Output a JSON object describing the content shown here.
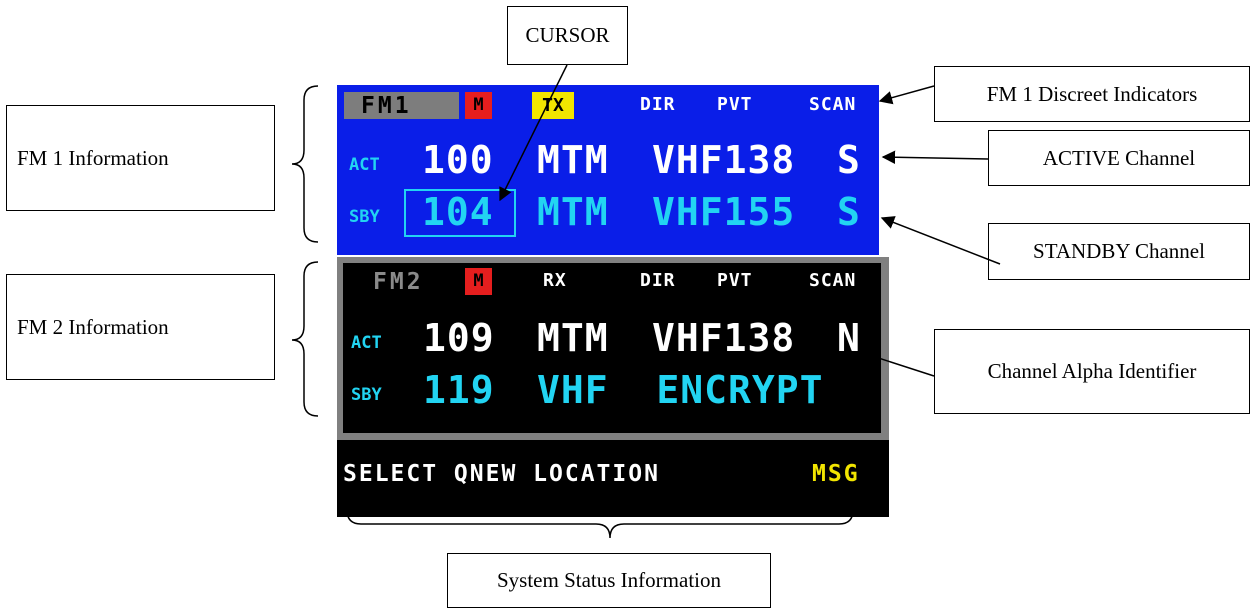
{
  "callouts": {
    "cursor": "CURSOR",
    "fm1_discreet": "FM 1 Discreet Indicators",
    "fm1_info": "FM 1 Information",
    "active": "ACTIVE Channel",
    "standby": "STANDBY Channel",
    "fm2_info": "FM 2 Information",
    "alpha_id": "Channel Alpha Identifier",
    "system_status": "System Status Information"
  },
  "fm1": {
    "name": "FM1",
    "mode": "M",
    "tx": "TX",
    "dir": "DIR",
    "pvt": "PVT",
    "scan": "SCAN",
    "act_label": "ACT",
    "act_channel": "100",
    "act_type": "MTM",
    "act_freq": "VHF138",
    "act_flag": "S",
    "sby_label": "SBY",
    "sby_channel": "104",
    "sby_type": "MTM",
    "sby_freq": "VHF155",
    "sby_flag": "S"
  },
  "fm2": {
    "name": "FM2",
    "mode": "M",
    "rx": "RX",
    "dir": "DIR",
    "pvt": "PVT",
    "scan": "SCAN",
    "act_label": "ACT",
    "act_channel": "109",
    "act_type": "MTM",
    "act_freq": "VHF138",
    "act_flag": "N",
    "sby_label": "SBY",
    "sby_channel": "119",
    "sby_alpha": "VHF  ENCRYPT"
  },
  "status": {
    "message": "SELECT QNEW LOCATION",
    "msg": "MSG"
  },
  "colors": {
    "fm1_bg": "#0a1ee8",
    "fm2_bg": "#000000",
    "white_text": "#ffffff",
    "cyan_text": "#22d4f2",
    "yellow_text": "#f2e500",
    "mode_red": "#e51e1e",
    "title_gray": "#7d7d7d"
  }
}
